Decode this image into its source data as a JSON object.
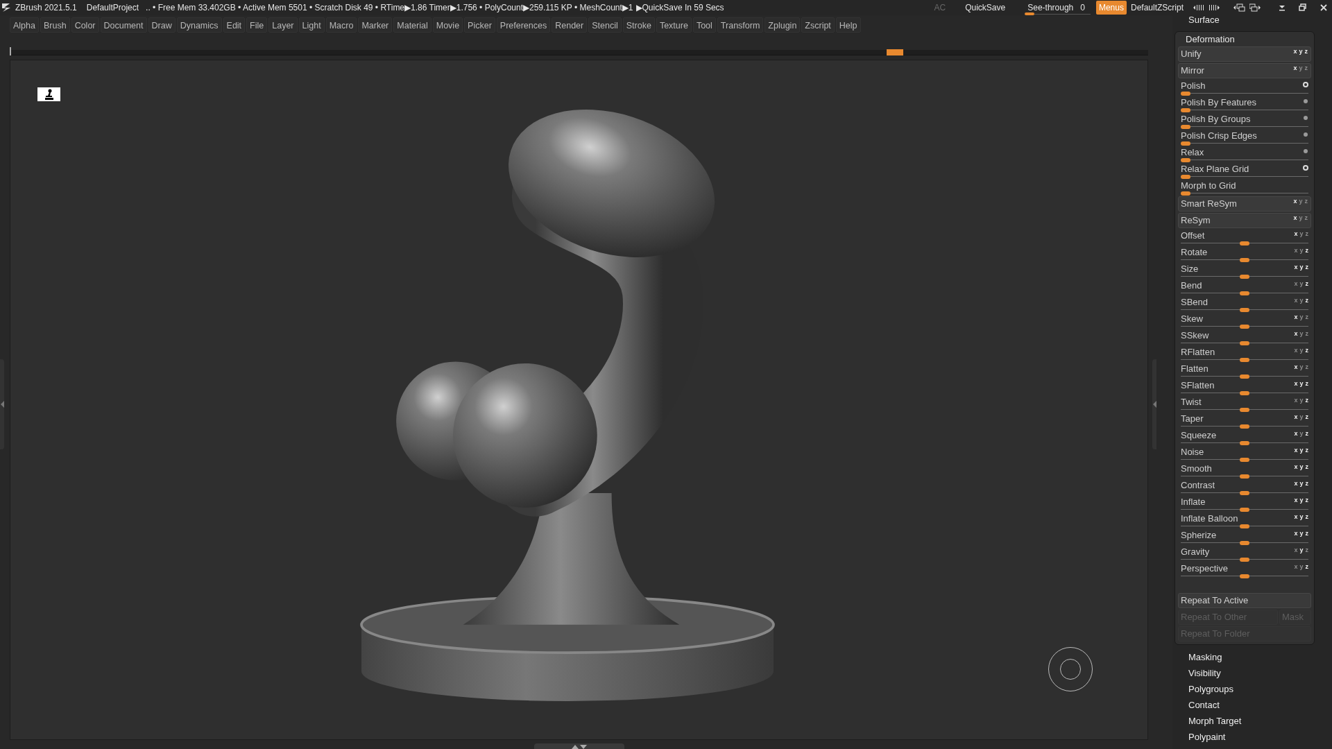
{
  "title_bar": {
    "app": "ZBrush 2021.5.1",
    "project": "DefaultProject",
    "stats": ".. • Free Mem 33.402GB • Active Mem 5501 • Scratch Disk 49 • RTime▶1.86 Timer▶1.756 • PolyCount▶259.115 KP • MeshCount▶1",
    "quicksave_timer": "▶QuickSave In 59 Secs",
    "ac": "AC",
    "quicksave": "QuickSave",
    "see_through": {
      "label": "See-through",
      "value": "0",
      "level": 0
    },
    "menus": {
      "label": "Menus",
      "selected": true
    },
    "script": "DefaultZScript"
  },
  "menu_bar": [
    "Alpha",
    "Brush",
    "Color",
    "Document",
    "Draw",
    "Dynamics",
    "Edit",
    "File",
    "Layer",
    "Light",
    "Macro",
    "Marker",
    "Material",
    "Movie",
    "Picker",
    "Preferences",
    "Render",
    "Stencil",
    "Stroke",
    "Texture",
    "Tool",
    "Transform",
    "Zplugin",
    "Zscript",
    "Help"
  ],
  "timeline": {
    "level": 0.77
  },
  "side_panel": {
    "title": "Surface",
    "deformation": {
      "title": "Deformation",
      "items": [
        {
          "kind": "button",
          "label": "Unify",
          "axes": [
            {
              "label": "x",
              "on": true
            },
            {
              "label": "y",
              "on": true
            },
            {
              "label": "z",
              "on": true
            }
          ]
        },
        {
          "kind": "button",
          "label": "Mirror",
          "axes": [
            {
              "label": "x",
              "on": true
            },
            {
              "label": "y",
              "on": false
            },
            {
              "label": "z",
              "on": false
            }
          ]
        },
        {
          "kind": "slider",
          "label": "Polish",
          "level": 0,
          "toggle": true
        },
        {
          "kind": "slider",
          "label": "Polish By Features",
          "level": 0,
          "toggle": false
        },
        {
          "kind": "slider",
          "label": "Polish By Groups",
          "level": 0,
          "toggle": false
        },
        {
          "kind": "slider",
          "label": "Polish Crisp Edges",
          "level": 0,
          "toggle": false
        },
        {
          "kind": "slider",
          "label": "Relax",
          "level": 0,
          "toggle": false
        },
        {
          "kind": "slider",
          "label": "Relax Plane Grid",
          "level": 0,
          "toggle": true
        },
        {
          "kind": "slider",
          "label": "Morph to Grid",
          "level": 0
        },
        {
          "kind": "button",
          "label": "Smart ReSym",
          "axes": [
            {
              "label": "x",
              "on": true
            },
            {
              "label": "y",
              "on": false
            },
            {
              "label": "z",
              "on": false
            }
          ]
        },
        {
          "kind": "button",
          "label": "ReSym",
          "axes": [
            {
              "label": "x",
              "on": true
            },
            {
              "label": "y",
              "on": false
            },
            {
              "label": "z",
              "on": false
            }
          ]
        },
        {
          "kind": "axis_slider",
          "label": "Offset",
          "level": 0.5,
          "axes": [
            {
              "label": "x",
              "on": true
            },
            {
              "label": "y",
              "on": false
            },
            {
              "label": "z",
              "on": false
            }
          ]
        },
        {
          "kind": "axis_slider",
          "label": "Rotate",
          "level": 0.5,
          "axes": [
            {
              "label": "x",
              "on": false
            },
            {
              "label": "y",
              "on": false
            },
            {
              "label": "z",
              "on": true
            }
          ]
        },
        {
          "kind": "axis_slider",
          "label": "Size",
          "level": 0.5,
          "axes": [
            {
              "label": "x",
              "on": true
            },
            {
              "label": "y",
              "on": true
            },
            {
              "label": "z",
              "on": true
            }
          ]
        },
        {
          "kind": "axis_slider",
          "label": "Bend",
          "level": 0.5,
          "axes": [
            {
              "label": "x",
              "on": false
            },
            {
              "label": "y",
              "on": false
            },
            {
              "label": "z",
              "on": true
            }
          ]
        },
        {
          "kind": "axis_slider",
          "label": "SBend",
          "level": 0.5,
          "axes": [
            {
              "label": "x",
              "on": false
            },
            {
              "label": "y",
              "on": false
            },
            {
              "label": "z",
              "on": true
            }
          ]
        },
        {
          "kind": "axis_slider",
          "label": "Skew",
          "level": 0.5,
          "axes": [
            {
              "label": "x",
              "on": true
            },
            {
              "label": "y",
              "on": false
            },
            {
              "label": "z",
              "on": false
            }
          ]
        },
        {
          "kind": "axis_slider",
          "label": "SSkew",
          "level": 0.5,
          "axes": [
            {
              "label": "x",
              "on": true
            },
            {
              "label": "y",
              "on": false
            },
            {
              "label": "z",
              "on": false
            }
          ]
        },
        {
          "kind": "axis_slider",
          "label": "RFlatten",
          "level": 0.5,
          "axes": [
            {
              "label": "x",
              "on": false
            },
            {
              "label": "y",
              "on": false
            },
            {
              "label": "z",
              "on": true
            }
          ]
        },
        {
          "kind": "axis_slider",
          "label": "Flatten",
          "level": 0.5,
          "axes": [
            {
              "label": "x",
              "on": true
            },
            {
              "label": "y",
              "on": false
            },
            {
              "label": "z",
              "on": false
            }
          ]
        },
        {
          "kind": "axis_slider",
          "label": "SFlatten",
          "level": 0.5,
          "axes": [
            {
              "label": "x",
              "on": true
            },
            {
              "label": "y",
              "on": true
            },
            {
              "label": "z",
              "on": true
            }
          ]
        },
        {
          "kind": "axis_slider",
          "label": "Twist",
          "level": 0.5,
          "axes": [
            {
              "label": "x",
              "on": false
            },
            {
              "label": "y",
              "on": false
            },
            {
              "label": "z",
              "on": true
            }
          ]
        },
        {
          "kind": "axis_slider",
          "label": "Taper",
          "level": 0.5,
          "axes": [
            {
              "label": "x",
              "on": true
            },
            {
              "label": "y",
              "on": false
            },
            {
              "label": "z",
              "on": true
            }
          ]
        },
        {
          "kind": "axis_slider",
          "label": "Squeeze",
          "level": 0.5,
          "axes": [
            {
              "label": "x",
              "on": true
            },
            {
              "label": "y",
              "on": false
            },
            {
              "label": "z",
              "on": true
            }
          ]
        },
        {
          "kind": "axis_slider",
          "label": "Noise",
          "level": 0.5,
          "axes": [
            {
              "label": "x",
              "on": true
            },
            {
              "label": "y",
              "on": true
            },
            {
              "label": "z",
              "on": true
            }
          ]
        },
        {
          "kind": "axis_slider",
          "label": "Smooth",
          "level": 0.5,
          "axes": [
            {
              "label": "x",
              "on": true
            },
            {
              "label": "y",
              "on": true
            },
            {
              "label": "z",
              "on": true
            }
          ]
        },
        {
          "kind": "axis_slider",
          "label": "Contrast",
          "level": 0.5,
          "axes": [
            {
              "label": "x",
              "on": true
            },
            {
              "label": "y",
              "on": true
            },
            {
              "label": "z",
              "on": true
            }
          ]
        },
        {
          "kind": "axis_slider",
          "label": "Inflate",
          "level": 0.5,
          "axes": [
            {
              "label": "x",
              "on": true
            },
            {
              "label": "y",
              "on": true
            },
            {
              "label": "z",
              "on": true
            }
          ]
        },
        {
          "kind": "axis_slider",
          "label": "Inflate Balloon",
          "level": 0.5,
          "axes": [
            {
              "label": "x",
              "on": true
            },
            {
              "label": "y",
              "on": true
            },
            {
              "label": "z",
              "on": true
            }
          ]
        },
        {
          "kind": "axis_slider",
          "label": "Spherize",
          "level": 0.5,
          "axes": [
            {
              "label": "x",
              "on": true
            },
            {
              "label": "y",
              "on": true
            },
            {
              "label": "z",
              "on": true
            }
          ]
        },
        {
          "kind": "axis_slider",
          "label": "Gravity",
          "level": 0.5,
          "axes": [
            {
              "label": "x",
              "on": false
            },
            {
              "label": "y",
              "on": true
            },
            {
              "label": "z",
              "on": false
            }
          ]
        },
        {
          "kind": "axis_slider",
          "label": "Perspective",
          "level": 0.5,
          "axes": [
            {
              "label": "x",
              "on": false
            },
            {
              "label": "y",
              "on": false
            },
            {
              "label": "z",
              "on": true
            }
          ]
        }
      ],
      "actions": [
        [
          {
            "label": "Repeat To Active",
            "disabled": false
          }
        ],
        [
          {
            "label": "Repeat To Other",
            "disabled": true
          },
          {
            "label": "Mask",
            "disabled": true
          }
        ],
        [
          {
            "label": "Repeat To Folder",
            "disabled": true
          }
        ]
      ]
    },
    "collapsed": [
      "Masking",
      "Visibility",
      "Polygroups",
      "Contact",
      "Morph Target",
      "Polypaint"
    ]
  }
}
